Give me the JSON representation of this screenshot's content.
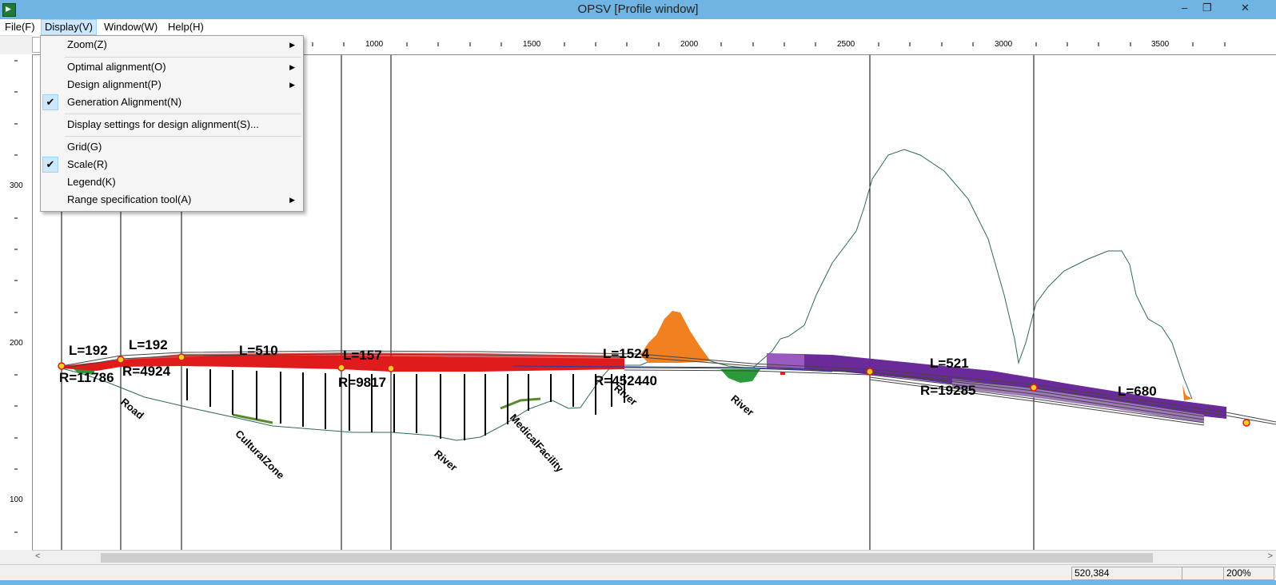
{
  "window": {
    "title": "OPSV [Profile window]",
    "minimize_glyph": "‒",
    "restore_glyph": "❐",
    "close_glyph": "✕"
  },
  "menubar": {
    "items": [
      {
        "label": "File(F)"
      },
      {
        "label": "Display(V)"
      },
      {
        "label": "Window(W)"
      },
      {
        "label": "Help(H)"
      }
    ]
  },
  "display_menu": {
    "items": [
      {
        "label": "Zoom(Z)",
        "submenu": true,
        "checked": false
      },
      {
        "label": "Optimal alignment(O)",
        "submenu": true,
        "checked": false
      },
      {
        "label": "Design alignment(P)",
        "submenu": true,
        "checked": false
      },
      {
        "label": "Generation Alignment(N)",
        "submenu": false,
        "checked": true
      },
      {
        "label": "Display settings for design alignment(S)...",
        "submenu": false,
        "checked": false
      },
      {
        "label": "Grid(G)",
        "submenu": false,
        "checked": false
      },
      {
        "label": "Scale(R)",
        "submenu": false,
        "checked": true
      },
      {
        "label": "Legend(K)",
        "submenu": false,
        "checked": false
      },
      {
        "label": "Range specification tool(A)",
        "submenu": true,
        "checked": false
      }
    ],
    "check_glyph": "✔",
    "arrow_glyph": "▶"
  },
  "ruler": {
    "x_labels": [
      "1000",
      "1500",
      "2000",
      "2500",
      "3000",
      "3500"
    ],
    "y_labels": [
      "300",
      "200",
      "100"
    ]
  },
  "profile": {
    "length_labels": [
      "L=192",
      "L=192",
      "L=510",
      "L=157",
      "L=1524",
      "L=521",
      "L=680"
    ],
    "radius_labels": [
      "R=11786",
      "R=4924",
      "R=9817",
      "R=452440",
      "R=19285"
    ],
    "feature_labels": [
      "Road",
      "CulturalZone",
      "River",
      "MedicalFacility",
      "River",
      "River"
    ],
    "colors": {
      "terrain": "#2f6b4f",
      "design": "#e01b1b",
      "tunnel": "#7a2fa0",
      "cut": "#f08020",
      "fill": "#2a9a3a",
      "vip": "#ffd21f"
    }
  },
  "hscroll": {
    "left_arrow": "<",
    "right_arrow": ">"
  },
  "status": {
    "coords": "520,384",
    "zoom": "200%"
  }
}
